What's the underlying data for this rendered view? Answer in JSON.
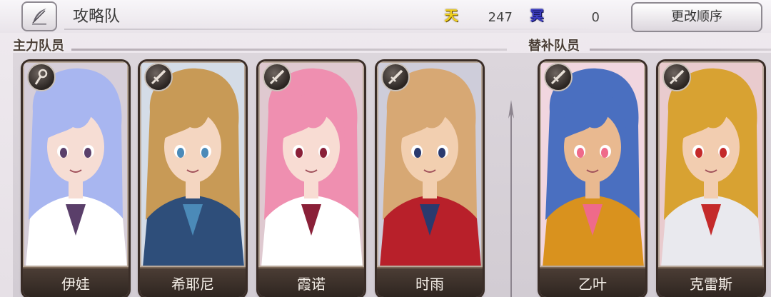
{
  "header": {
    "title": "攻略队",
    "sky_symbol": "天",
    "sky_count": "247",
    "dark_symbol": "冥",
    "dark_count": "0",
    "change_order_label": "更改顺序"
  },
  "sections": {
    "main_label": "主力队员",
    "sub_label": "替补队员"
  },
  "main_members": [
    {
      "name": "伊娃",
      "role_icon": "staff-icon",
      "hair": "#a8b6f0",
      "skin": "#f6ddd4",
      "outfit": "#ffffff",
      "accent": "#5a3f6a"
    },
    {
      "name": "希耶尼",
      "role_icon": "sword-icon",
      "hair": "#c89a56",
      "skin": "#f4d6c1",
      "outfit": "#2e4e7a",
      "accent": "#4b8ab8"
    },
    {
      "name": "霞诺",
      "role_icon": "sword-icon",
      "hair": "#ef8fb0",
      "skin": "#f8dcd3",
      "outfit": "#ffffff",
      "accent": "#8a2038"
    },
    {
      "name": "时雨",
      "role_icon": "sword-icon",
      "hair": "#d7a874",
      "skin": "#f2cfb0",
      "outfit": "#b8202a",
      "accent": "#2a3a6e"
    }
  ],
  "sub_members": [
    {
      "name": "乙叶",
      "role_icon": "sword-icon",
      "hair": "#4a6fc0",
      "skin": "#e9b990",
      "outfit": "#d9921e",
      "accent": "#ef6a8a"
    },
    {
      "name": "克雷斯",
      "role_icon": "sword-icon",
      "hair": "#d8a232",
      "skin": "#f2cdb0",
      "outfit": "#e9e9ee",
      "accent": "#c42a2a"
    }
  ]
}
